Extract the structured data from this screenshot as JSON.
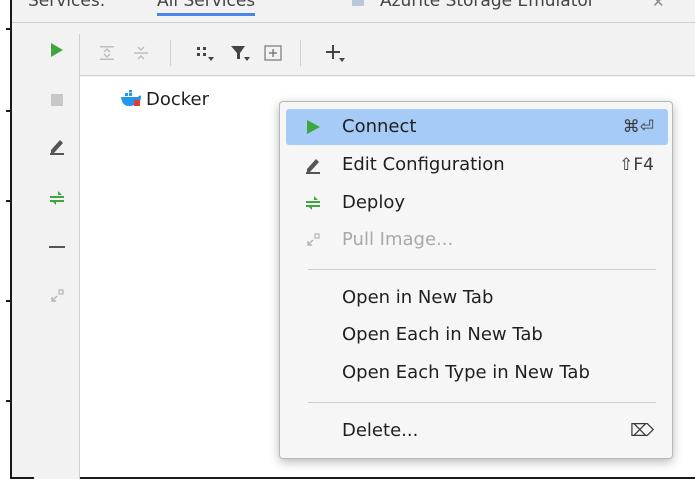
{
  "tabs": [
    {
      "label": "Services:"
    },
    {
      "label": "All Services"
    },
    {
      "label": "Azurite Storage Emulator"
    }
  ],
  "tab_close_glyph": "✕",
  "tree": {
    "items": [
      {
        "label": "Docker",
        "icon": "docker-icon"
      }
    ]
  },
  "context_menu": {
    "items": [
      {
        "label": "Connect",
        "shortcut": "⌘⏎",
        "icon": "run-icon"
      },
      {
        "label": "Edit Configuration",
        "shortcut": "⇧F4",
        "icon": "edit-icon"
      },
      {
        "label": "Deploy",
        "shortcut": "",
        "icon": "deploy-icon"
      },
      {
        "label": "Pull Image...",
        "shortcut": "",
        "icon": "pull-image-icon"
      },
      {
        "label": "Open in New Tab",
        "shortcut": ""
      },
      {
        "label": "Open Each in New Tab",
        "shortcut": ""
      },
      {
        "label": "Open Each Type in New Tab",
        "shortcut": ""
      },
      {
        "label": "Delete...",
        "shortcut": "⌦",
        "icon": "delete-key-icon"
      }
    ]
  },
  "colors": {
    "accent": "#4a86e8",
    "selection": "#a6cbf7",
    "run_green": "#3fa63f",
    "disabled_text": "#a9a9a9",
    "docker_blue": "#2496ed"
  }
}
